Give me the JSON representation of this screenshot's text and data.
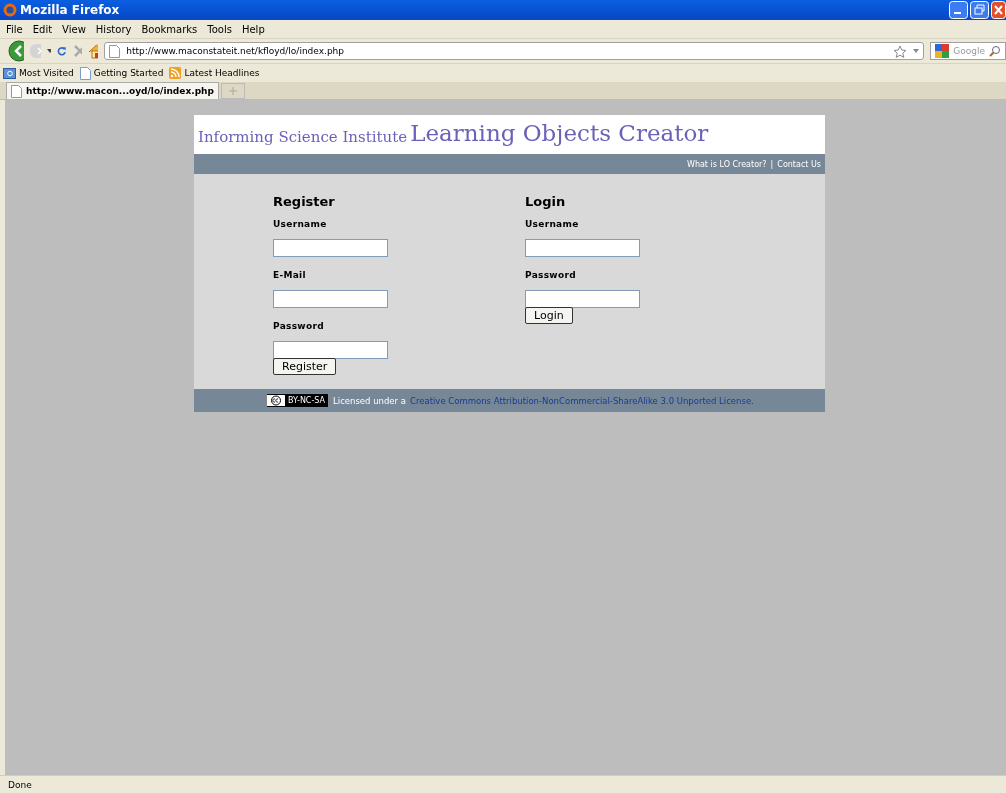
{
  "window": {
    "title": "Mozilla Firefox"
  },
  "menu": [
    "File",
    "Edit",
    "View",
    "History",
    "Bookmarks",
    "Tools",
    "Help"
  ],
  "address": {
    "url": "http://www.maconstateit.net/kfloyd/lo/index.php"
  },
  "search": {
    "placeholder": "Google"
  },
  "bookmarks": [
    {
      "label": "Most Visited",
      "kind": "folder"
    },
    {
      "label": "Getting Started",
      "kind": "page"
    },
    {
      "label": "Latest Headlines",
      "kind": "feed"
    }
  ],
  "tabs": [
    {
      "label": "http://www.macon...oyd/lo/index.php",
      "selected": true
    }
  ],
  "page": {
    "logo_small": "Informing Science Institute",
    "logo_large": "Learning Objects Creator",
    "nav": [
      "What is LO Creator?",
      "|",
      "Contact Us"
    ],
    "forms": [
      {
        "heading": "Register",
        "fields": [
          "Username",
          "E-Mail",
          "Password"
        ],
        "button": "Register"
      },
      {
        "heading": "Login",
        "fields": [
          "Username",
          "Password"
        ],
        "button": "Login"
      }
    ],
    "footer": {
      "badge": "BY-NC-SA",
      "text": "Licensed under a",
      "link": "Creative Commons Attribution-NonCommercial-ShareAlike 3.0 Unported License."
    }
  },
  "status_bar": "Done"
}
